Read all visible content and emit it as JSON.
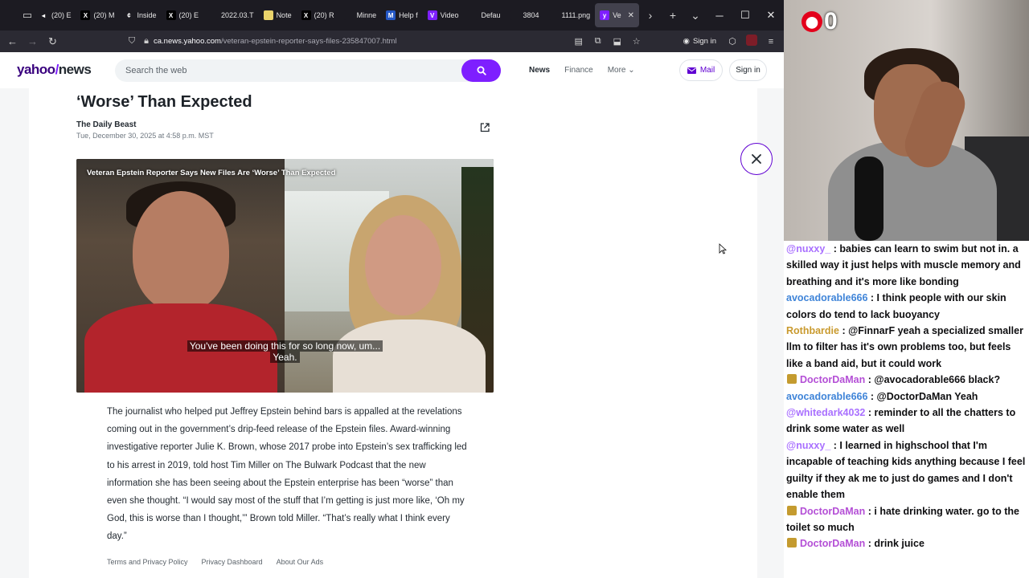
{
  "browser": {
    "tabs": [
      {
        "label": "(20) E",
        "fav": "◂",
        "color": "#1c1b22"
      },
      {
        "label": "(20) M",
        "fav": "X",
        "color": "#000000"
      },
      {
        "label": "Inside",
        "fav": "¢",
        "color": "#1c1b22"
      },
      {
        "label": "(20) E",
        "fav": "X",
        "color": "#000000"
      },
      {
        "label": "2022.03.T",
        "fav": "",
        "color": "#1c1b22"
      },
      {
        "label": "Note",
        "fav": "",
        "color": "#e9d36b"
      },
      {
        "label": "(20) R",
        "fav": "X",
        "color": "#000000"
      },
      {
        "label": "Minne",
        "fav": "",
        "color": "#1c1b22"
      },
      {
        "label": "Help f",
        "fav": "M",
        "color": "#2458c6"
      },
      {
        "label": "Video",
        "fav": "V",
        "color": "#7e1fff"
      },
      {
        "label": "Defau",
        "fav": "",
        "color": "#1c1b22"
      },
      {
        "label": "3804",
        "fav": "",
        "color": "#1c1b22"
      },
      {
        "label": "1111.png",
        "fav": "",
        "color": "#1c1b22"
      },
      {
        "label": "Ve",
        "fav": "y",
        "color": "#7e1fff",
        "active": true
      }
    ],
    "url_domain": "ca.news.yahoo.com",
    "url_path": "/veteran-epstein-reporter-says-files-235847007.html",
    "signin_label": "Sign in"
  },
  "yahoo": {
    "logo_brand": "yahoo",
    "logo_slash": "/",
    "logo_news": "news",
    "search_placeholder": "Search the web",
    "nav": [
      "News",
      "Finance",
      "More"
    ],
    "mail_label": "Mail",
    "signin_label": "Sign in"
  },
  "article": {
    "headline": "‘Worse’ Than Expected",
    "source": "The Daily Beast",
    "date": "Tue, December 30, 2025 at 4:58 p.m. MST",
    "video_title": "Veteran Epstein Reporter Says New Files Are ‘Worse’ Than Expected",
    "video_caption_line1": "You've been doing this for so long now, um...",
    "video_caption_line2": "Yeah.",
    "body": "The journalist who helped put Jeffrey Epstein behind bars is appalled at the revelations coming out in the government’s drip-feed release of the Epstein files. Award-winning investigative reporter Julie K. Brown, whose 2017 probe into Epstein’s sex trafficking led to his arrest in 2019, told host Tim Miller on The Bulwark Podcast that the new information she has been seeing about the Epstein enterprise has been “worse” than even she thought. “I would say most of the stuff that I’m getting is just more like, ‘Oh my God, this is worse than I thought,’” Brown told Miller. “That’s really what I think every day.”",
    "footer_links": [
      "Terms and Privacy Policy",
      "Privacy Dashboard",
      "About Our Ads"
    ]
  },
  "stream": {
    "counter": "0",
    "chat": [
      {
        "user": "@nuxxy_",
        "color": "#a970ff",
        "badge": false,
        "text": " : babies can learn to swim but not in. a skilled way it just helps with muscle memory and breathing and it's more like bonding"
      },
      {
        "user": "avocadorable666",
        "color": "#3f84d8",
        "badge": false,
        "text": " : I think people with our skin colors do tend to lack buoyancy"
      },
      {
        "user": "Rothbardie",
        "color": "#c99a2e",
        "badge": false,
        "text": " : @FinnarF yeah a specialized smaller llm to filter has it's own problems too, but feels like a band aid, but it could work"
      },
      {
        "user": "DoctorDaMan",
        "color": "#b44fd6",
        "badge": true,
        "text": " : @avocadorable666 black?"
      },
      {
        "user": "avocadorable666",
        "color": "#3f84d8",
        "badge": false,
        "text": " : @DoctorDaMan Yeah"
      },
      {
        "user": "@whitedark4032",
        "color": "#a970ff",
        "badge": false,
        "text": " : reminder to all the chatters to drink some water as well"
      },
      {
        "user": "@nuxxy_",
        "color": "#a970ff",
        "badge": false,
        "text": " : I learned in highschool that I'm incapable of teaching kids anything because I feel guilty if they ak me to just do games and I don't enable them"
      },
      {
        "user": "DoctorDaMan",
        "color": "#b44fd6",
        "badge": true,
        "text": " : i hate drinking water. go to the toilet so much"
      },
      {
        "user": "DoctorDaMan",
        "color": "#b44fd6",
        "badge": true,
        "text": " : drink juice"
      }
    ]
  }
}
